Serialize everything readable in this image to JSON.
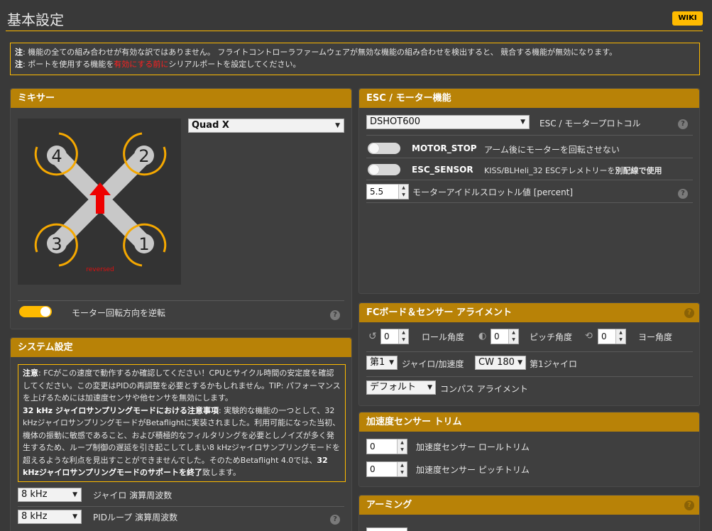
{
  "header": {
    "title": "基本設定",
    "wiki_label": "WIKI"
  },
  "note": {
    "line1_prefix": "注",
    "line1_text": ": 機能の全ての組み合わせが有効な訳ではありません。 フライトコントローラファームウェアが無効な機能の組み合わせを検出すると、 競合する機能が無効になります。",
    "line2_prefix": "注",
    "line2_text_a": ": ポートを使用する機能を",
    "line2_red": "有効にする前に",
    "line2_text_b": "シリアルポートを設定してください。"
  },
  "mixer": {
    "title": "ミキサー",
    "selected": "Quad X",
    "motors": [
      "4",
      "2",
      "3",
      "1"
    ],
    "reversed_label": "reversed",
    "reverse_toggle_label": "モーター回転方向を逆転",
    "reverse_toggle_on": true
  },
  "esc": {
    "title": "ESC / モーター機能",
    "protocol_value": "DSHOT600",
    "protocol_label": "ESC / モータープロトコル",
    "motor_stop_name": "MOTOR_STOP",
    "motor_stop_desc": "アーム後にモーターを回転させない",
    "esc_sensor_name": "ESC_SENSOR",
    "esc_sensor_desc_a": "KISS/BLHeli_32 ESCテレメトリーを",
    "esc_sensor_desc_b": "別配線で使用",
    "idle_value": "5.5",
    "idle_label": "モーターアイドルスロットル値 [percent]"
  },
  "board": {
    "title": "FCボード＆センサー アライメント",
    "roll_value": "0",
    "roll_label": "ロール角度",
    "pitch_value": "0",
    "pitch_label": "ピッチ角度",
    "yaw_value": "0",
    "yaw_label": "ヨー角度",
    "gyro_sel": "第1",
    "gyro_sel_label": "ジャイロ/加速度",
    "gyro_align": "CW 180",
    "gyro_align_label": "第1ジャイロ",
    "compass_sel": "デフォルト",
    "compass_label": "コンパス アライメント"
  },
  "accel": {
    "title": "加速度センサー トリム",
    "roll_value": "0",
    "roll_label": "加速度センサー ロールトリム",
    "pitch_value": "0",
    "pitch_label": "加速度センサー ピッチトリム"
  },
  "arming": {
    "title": "アーミング"
  },
  "system": {
    "title": "システム設定",
    "warn_p1_bold": "注意",
    "warn_p1": ": FCがこの速度で動作するか確認してください！CPUとサイクル時間の安定度を確認してください。この変更はPIDの再調整を必要とするかもしれません。TIP: パフォーマンスを上げるためには加速度センサや他センサを無効にします。",
    "warn_p2_bold": "32 kHz ジャイロサンプリングモードにおける注意事項",
    "warn_p2": ": 実験的な機能の一つとして、32 kHzジャイロサンプリングモードがBetaflightに実装されました。利用可能になった当初、機体の振動に敏感であること、および積極的なフィルタリングを必要としノイズが多く発生するため、ループ制御の遅延を引き起こしてしまい8 kHzジャイロサンプリングモードを超えるような利点を見出すことができませんでした。そのためBetaflight 4.0では、",
    "warn_p2_end_bold": "32 kHzジャイロサンプリングモードのサポートを終了",
    "warn_p2_end": "致します。",
    "gyro_freq": "8 kHz",
    "gyro_freq_label": "ジャイロ 演算周波数",
    "pid_freq": "8 kHz",
    "pid_freq_label": "PIDループ 演算周波数"
  },
  "colors": {
    "accent": "#ffbb00",
    "header": "#b88207",
    "motor": "#f5a800",
    "arrow": "#ee0000"
  }
}
